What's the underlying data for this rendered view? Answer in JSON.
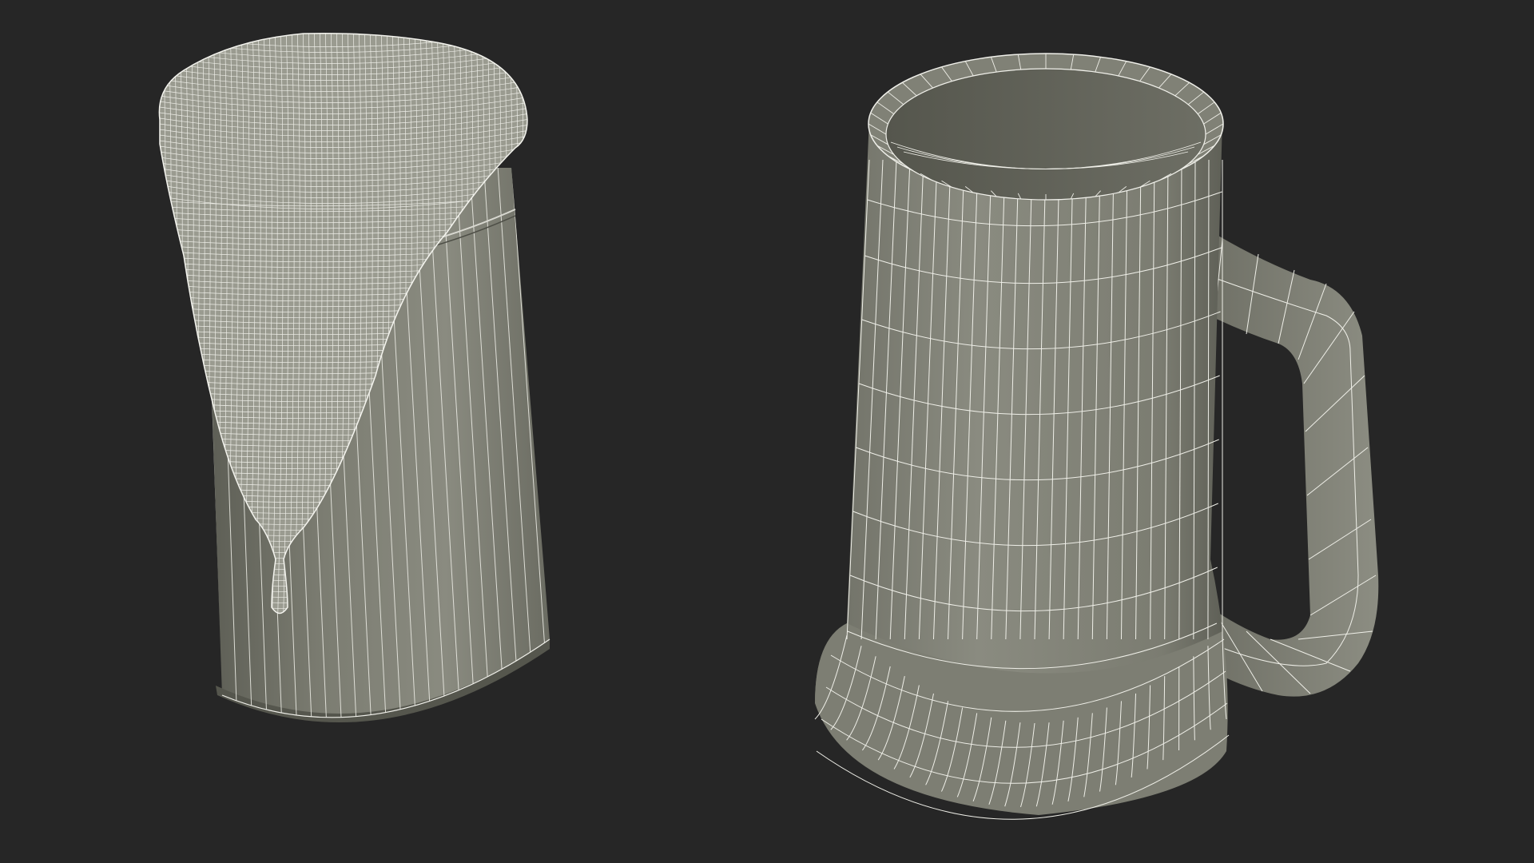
{
  "scene": {
    "background": "#262626",
    "mesh_fill": "#7a7b70",
    "mesh_fill_dark": "#5e5f56",
    "mesh_fill_light": "#8d8e83",
    "wire_color": "#eeeeea",
    "objects": [
      {
        "name": "foam-filled-liquid-column",
        "view": "wireframe-over-shaded"
      },
      {
        "name": "empty-beer-mug",
        "view": "wireframe-over-shaded"
      }
    ]
  }
}
